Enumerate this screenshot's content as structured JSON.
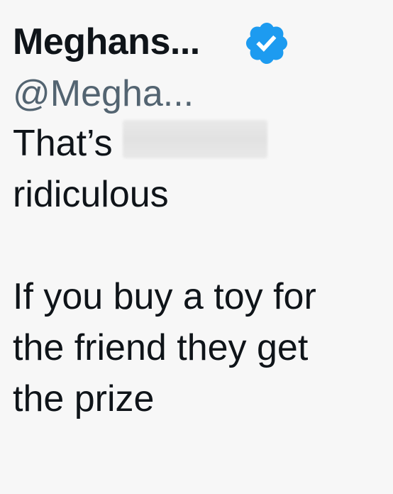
{
  "tweet": {
    "display_name": "Meghans...",
    "handle": "@Megha...",
    "verified_icon": "verified-badge-icon",
    "badge_color": "#1d9bf0",
    "body": {
      "line1": "That’s",
      "line2": "ridiculous",
      "line3": "If you buy a toy for",
      "line4": "the friend they get",
      "line5": "the prize"
    }
  }
}
